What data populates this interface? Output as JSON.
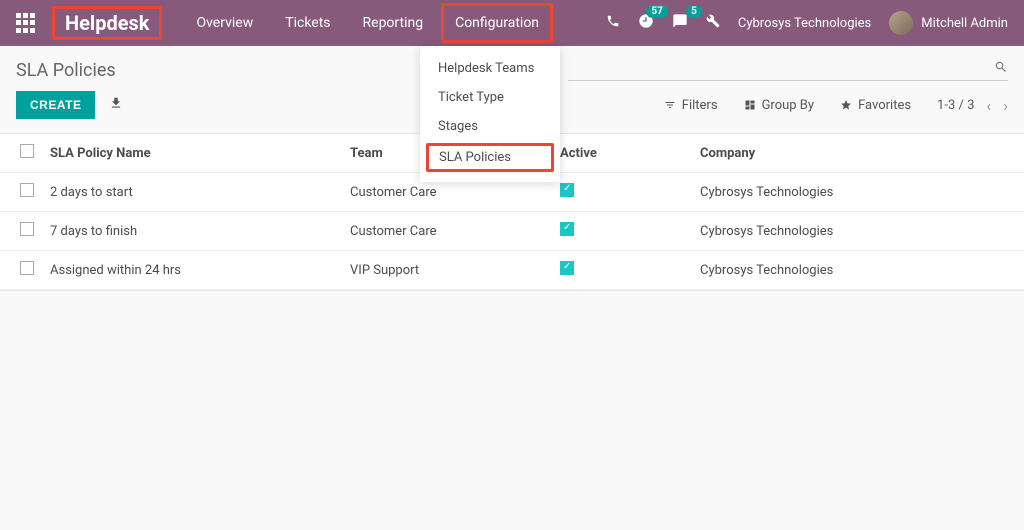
{
  "brand": "Helpdesk",
  "nav": {
    "overview": "Overview",
    "tickets": "Tickets",
    "reporting": "Reporting",
    "configuration": "Configuration"
  },
  "badges": {
    "activities": "57",
    "messages": "5"
  },
  "company_name": "Cybrosys Technologies",
  "user_name": "Mitchell Admin",
  "dropdown": {
    "helpdesk_teams": "Helpdesk Teams",
    "ticket_type": "Ticket Type",
    "stages": "Stages",
    "sla_policies": "SLA Policies"
  },
  "page_title": "SLA Policies",
  "create_label": "CREATE",
  "toolbar": {
    "filters": "Filters",
    "group_by": "Group By",
    "favorites": "Favorites"
  },
  "pager": "1-3 / 3",
  "columns": {
    "name": "SLA Policy Name",
    "team": "Team",
    "active": "Active",
    "company": "Company"
  },
  "rows": [
    {
      "name": "2 days to start",
      "team": "Customer Care",
      "active": true,
      "company": "Cybrosys Technologies"
    },
    {
      "name": "7 days to finish",
      "team": "Customer Care",
      "active": true,
      "company": "Cybrosys Technologies"
    },
    {
      "name": "Assigned within 24 hrs",
      "team": "VIP Support",
      "active": true,
      "company": "Cybrosys Technologies"
    }
  ]
}
